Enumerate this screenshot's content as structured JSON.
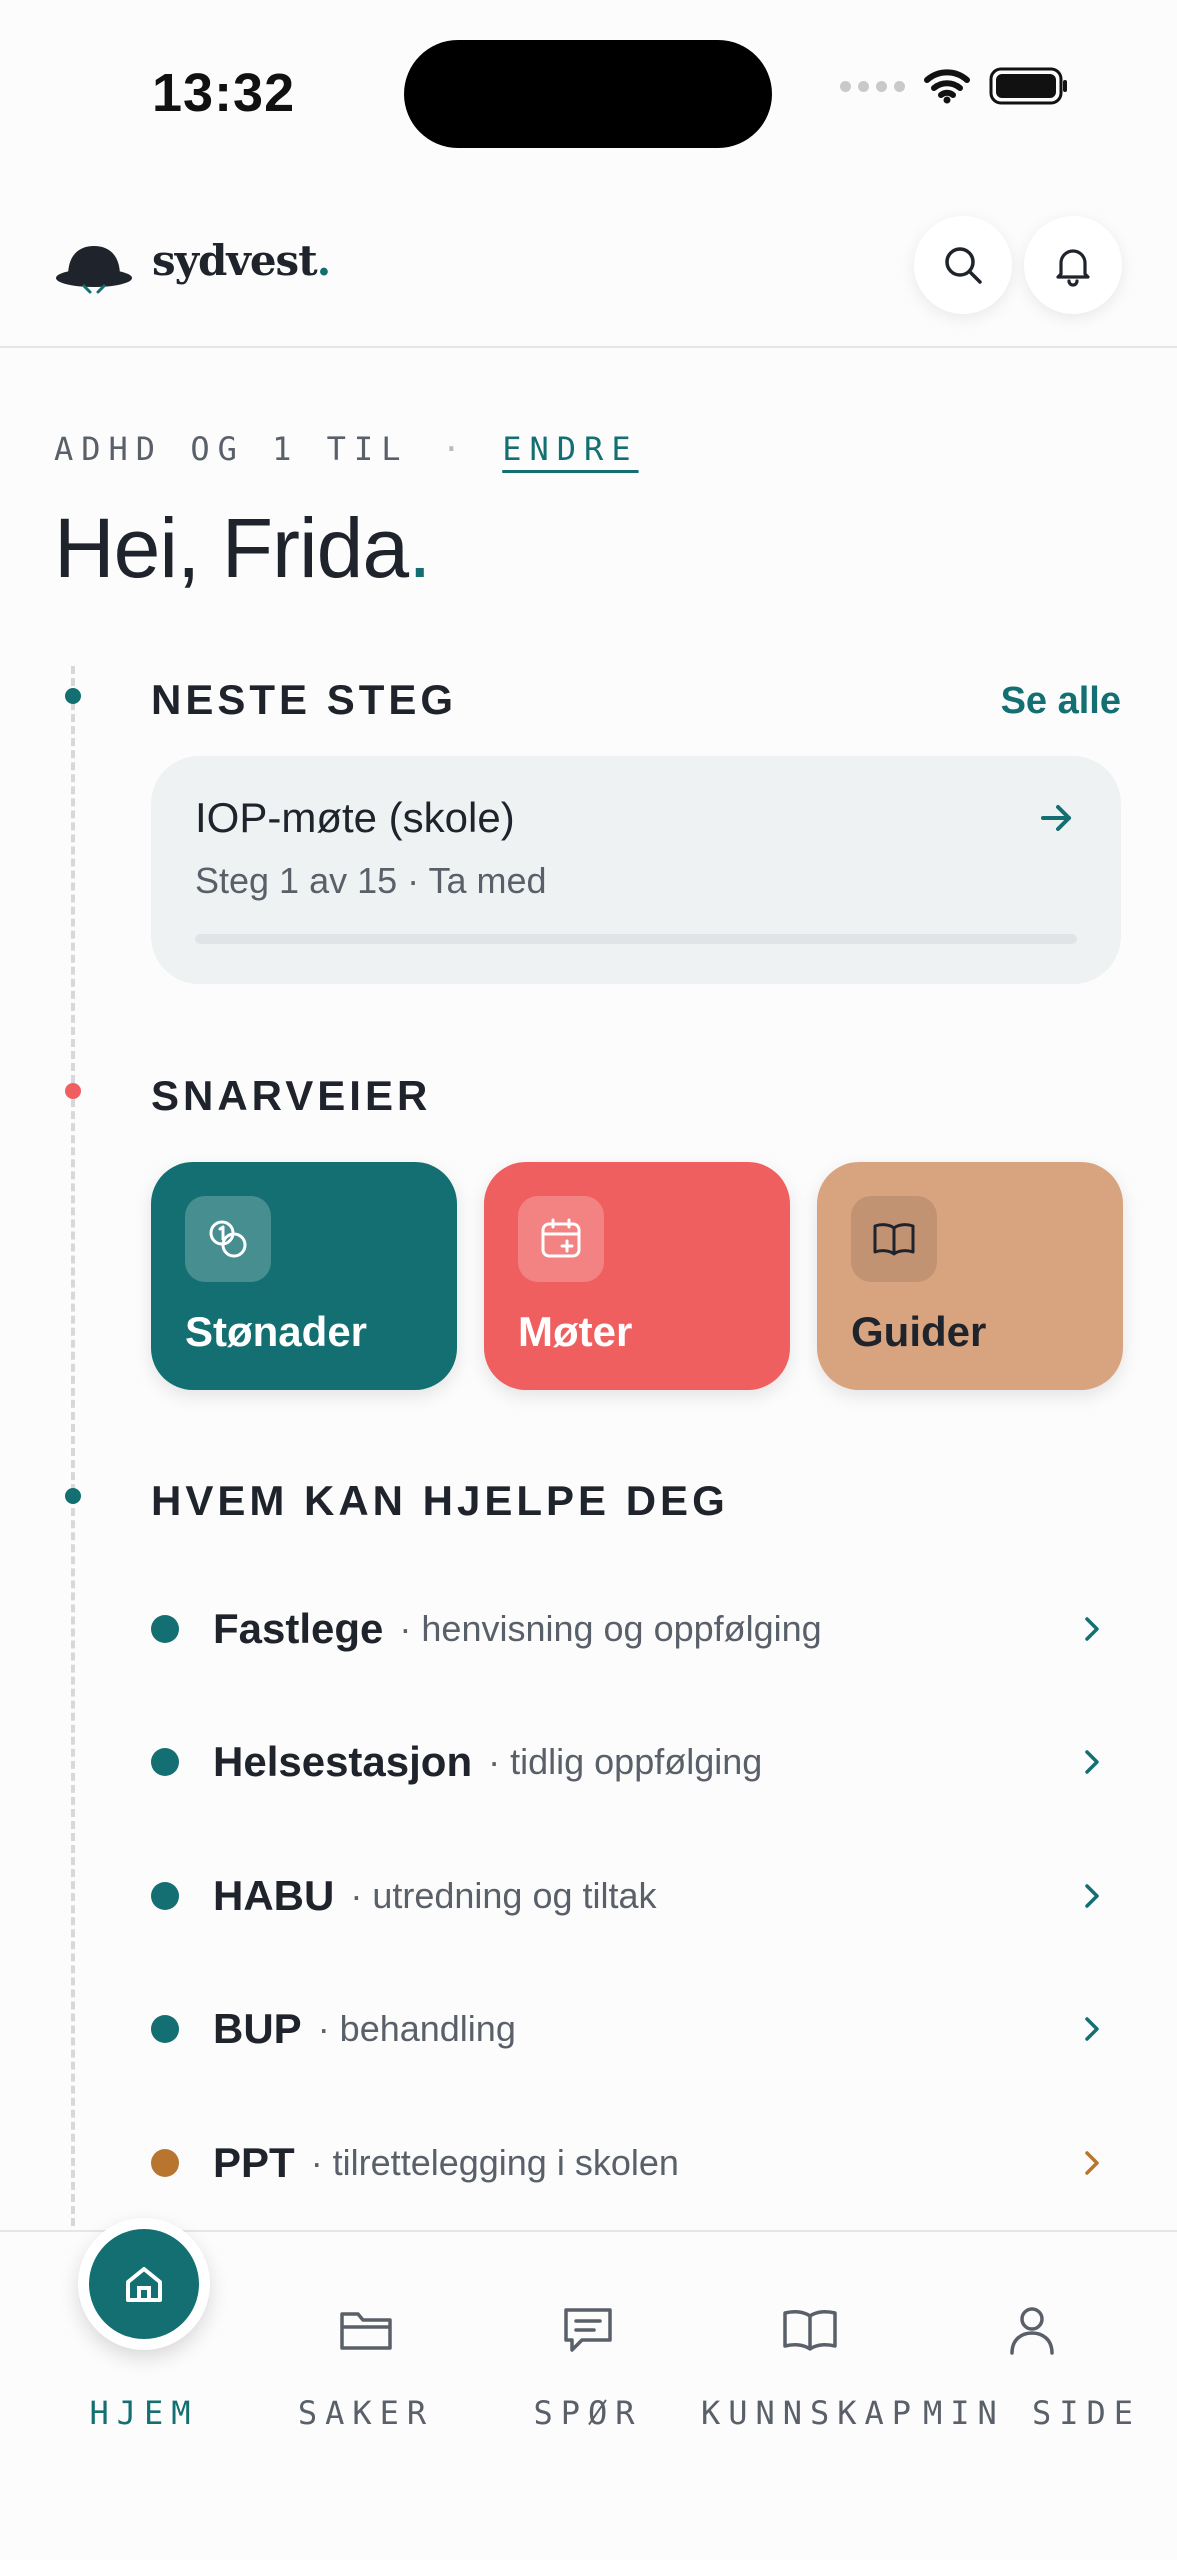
{
  "status_bar": {
    "time": "13:32"
  },
  "header": {
    "logo_text": "sydvest",
    "logo_dot": "."
  },
  "context": {
    "label": "ADHD OG 1 TIL",
    "separator": "·",
    "change_label": "ENDRE"
  },
  "greeting": {
    "text": "Hei, Frida",
    "dot": "."
  },
  "next_step": {
    "title": "NESTE STEG",
    "see_all": "Se alle",
    "card": {
      "title": "IOP-møte (skole)",
      "subtitle": "Steg 1 av 15 · Ta med",
      "progress": 0.0
    }
  },
  "shortcuts": {
    "title": "SNARVEIER",
    "items": [
      {
        "label": "Stønader",
        "icon": "coins-icon",
        "color": "#136f71"
      },
      {
        "label": "Møter",
        "icon": "calendar-plus-icon",
        "color": "#f05f5f"
      },
      {
        "label": "Guider",
        "icon": "book-icon",
        "color": "#d8a47f"
      }
    ]
  },
  "help": {
    "title": "HVEM KAN HJELPE DEG",
    "items": [
      {
        "name": "Fastlege",
        "desc": "· henvisning og oppfølging",
        "color": "#136f71"
      },
      {
        "name": "Helsestasjon",
        "desc": "· tidlig oppfølging",
        "color": "#136f71"
      },
      {
        "name": "HABU",
        "desc": "· utredning og tiltak",
        "color": "#136f71"
      },
      {
        "name": "BUP",
        "desc": "· behandling",
        "color": "#136f71"
      },
      {
        "name": "PPT",
        "desc": "· tilrettelegging i skolen",
        "color": "#b87530"
      }
    ]
  },
  "nav": {
    "items": [
      {
        "label": "HJEM",
        "icon": "home-icon",
        "active": true
      },
      {
        "label": "SAKER",
        "icon": "folder-icon",
        "active": false
      },
      {
        "label": "SPØR",
        "icon": "chat-icon",
        "active": false
      },
      {
        "label": "KUNNSKAP",
        "icon": "book-icon",
        "active": false
      },
      {
        "label": "MIN SIDE",
        "icon": "user-icon",
        "active": false
      }
    ]
  },
  "colors": {
    "accent": "#136f71",
    "coral": "#f05f5f",
    "sand": "#d8a47f",
    "orange": "#b87530"
  }
}
